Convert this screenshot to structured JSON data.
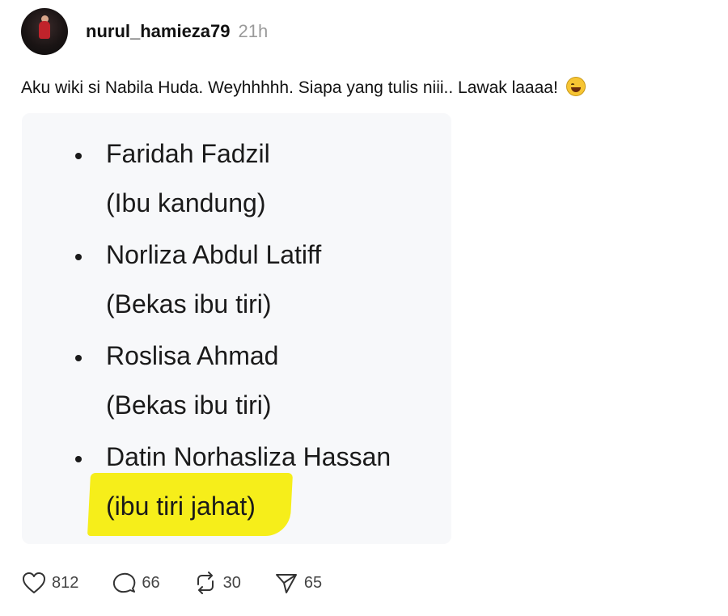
{
  "post": {
    "username": "nurul_hamieza79",
    "time": "21h",
    "caption": "Aku wiki si Nabila Huda. Weyhhhhh. Siapa yang tulis niii.. Lawak laaaa!",
    "caption_emoji": "face-with-tears-of-joy-icon"
  },
  "image": {
    "items": [
      {
        "name": "Faridah Fadzil",
        "role": "(Ibu kandung)"
      },
      {
        "name": "Norliza Abdul Latiff",
        "role": "(Bekas ibu tiri)"
      },
      {
        "name": "Roslisa Ahmad",
        "role": "(Bekas ibu tiri)"
      },
      {
        "name": "Datin Norhasliza Hassan",
        "role": "(ibu tiri jahat)"
      }
    ],
    "highlight_color": "#f6ee1a"
  },
  "actions": {
    "likes": "812",
    "comments": "66",
    "reposts": "30",
    "shares": "65"
  }
}
